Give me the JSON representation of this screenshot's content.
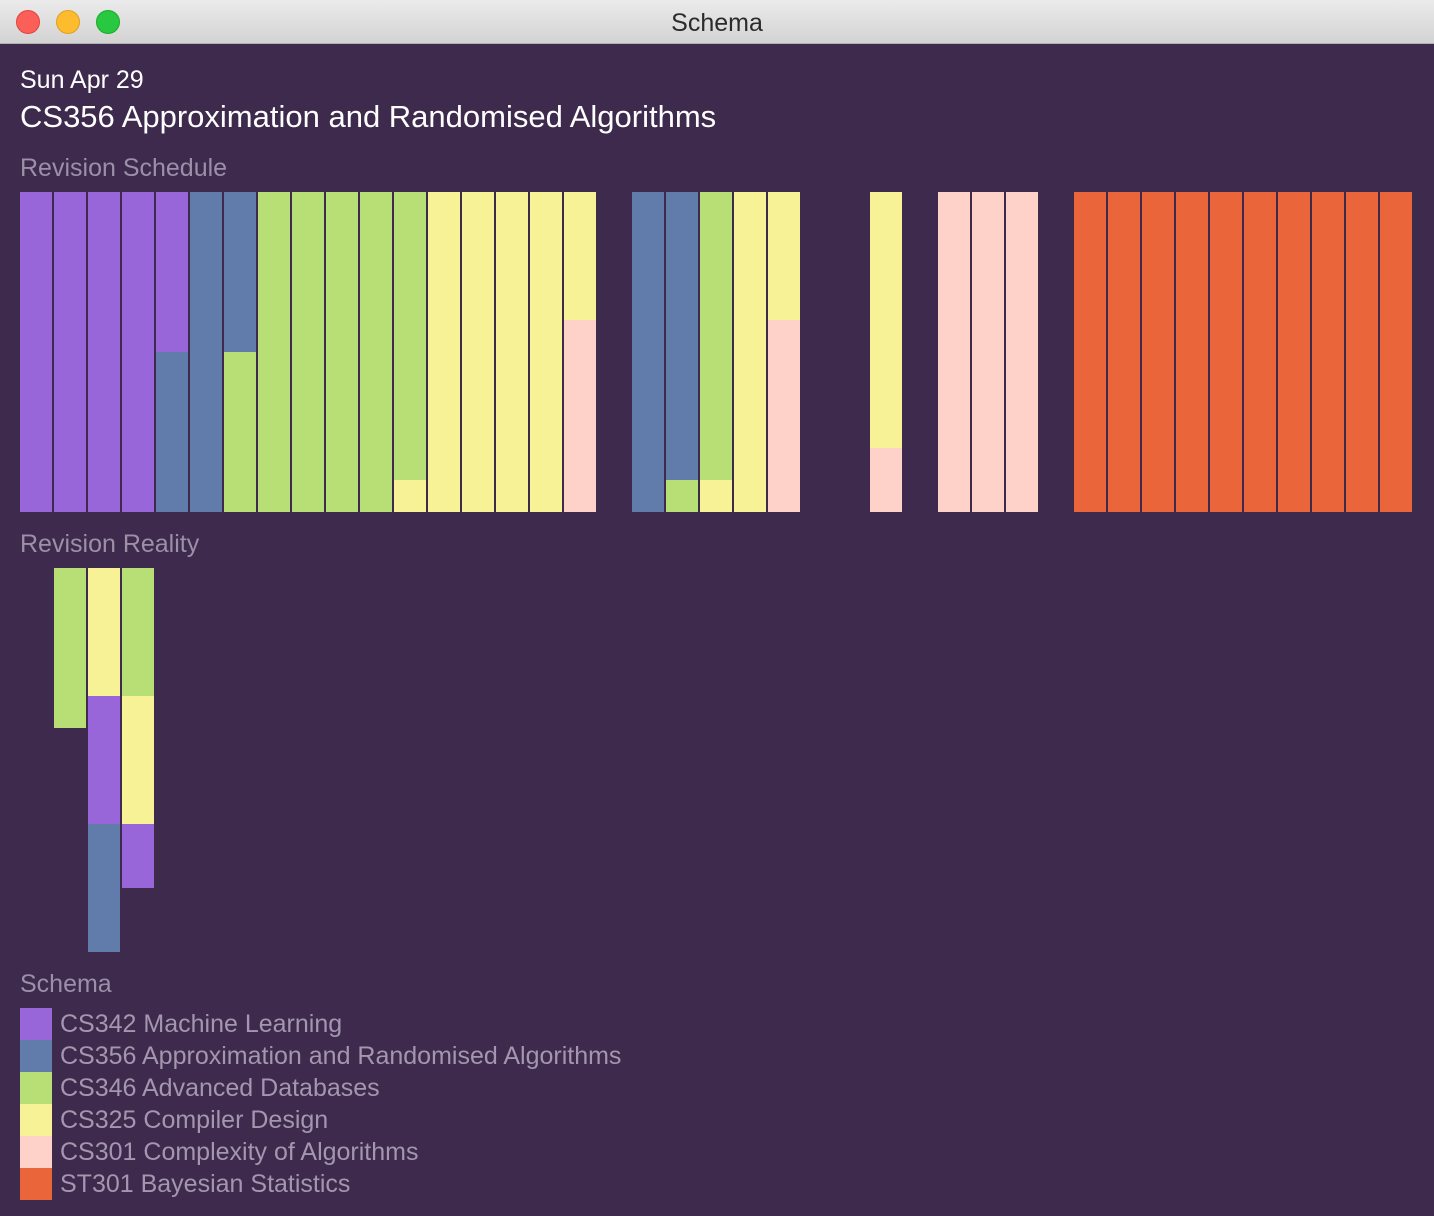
{
  "window": {
    "title": "Schema"
  },
  "header": {
    "date": "Sun Apr 29",
    "course": "CS356 Approximation and Randomised Algorithms"
  },
  "schedule": {
    "title": "Revision Schedule",
    "columns": [
      [
        "CS342"
      ],
      [
        "CS342"
      ],
      [
        "CS342"
      ],
      [
        "CS342"
      ],
      [
        "CS342",
        "CS356"
      ],
      [
        "CS356"
      ],
      [
        "CS356",
        "CS346"
      ],
      [
        "CS346"
      ],
      [
        "CS346"
      ],
      [
        "CS346"
      ],
      [
        "CS346"
      ],
      [
        "CS346",
        "CS325"
      ],
      [
        "CS325"
      ],
      [
        "CS325"
      ],
      [
        "CS325"
      ],
      [
        "CS325"
      ],
      [
        "CS325",
        "CS301"
      ],
      null,
      [
        "CS356"
      ],
      [
        "CS356",
        "CS346"
      ],
      [
        "CS346",
        "CS325"
      ],
      [
        "CS325"
      ],
      [
        "CS325",
        "CS301"
      ],
      null,
      null,
      [
        "CS325",
        "CS301"
      ],
      null,
      [
        "CS301"
      ],
      [
        "CS301"
      ],
      [
        "CS301"
      ],
      null,
      [
        "ST301"
      ],
      [
        "ST301"
      ],
      [
        "ST301"
      ],
      [
        "ST301"
      ],
      [
        "ST301"
      ],
      [
        "ST301"
      ],
      [
        "ST301"
      ],
      [
        "ST301"
      ],
      [
        "ST301"
      ],
      [
        "ST301"
      ]
    ]
  },
  "reality": {
    "title": "Revision Reality",
    "columns": [
      [],
      [
        [
          "CS346",
          5
        ]
      ],
      [
        [
          "CS325",
          4
        ],
        [
          "CS342",
          4
        ],
        [
          "CS356",
          4
        ]
      ],
      [
        [
          "CS346",
          4
        ],
        [
          "CS325",
          4
        ],
        [
          "CS342",
          2
        ]
      ]
    ]
  },
  "legend": {
    "title": "Schema",
    "items": [
      {
        "code": "CS342",
        "label": "CS342 Machine Learning",
        "color": "#9966d9"
      },
      {
        "code": "CS356",
        "label": "CS356 Approximation and Randomised Algorithms",
        "color": "#617bab"
      },
      {
        "code": "CS346",
        "label": "CS346 Advanced Databases",
        "color": "#b8df75"
      },
      {
        "code": "CS325",
        "label": "CS325 Compiler Design",
        "color": "#f6f295"
      },
      {
        "code": "CS301",
        "label": "CS301 Complexity of Algorithms",
        "color": "#fed2c9"
      },
      {
        "code": "ST301",
        "label": "ST301 Bayesian Statistics",
        "color": "#eb653a"
      }
    ]
  }
}
